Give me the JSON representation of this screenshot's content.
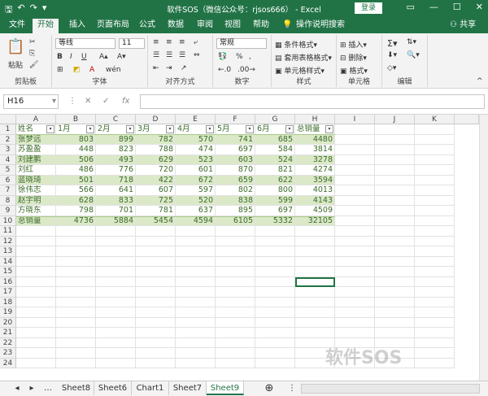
{
  "window": {
    "title": "软件SOS（微信公众号：rjsos666） - Excel",
    "login": "登录"
  },
  "tabs": [
    "文件",
    "开始",
    "插入",
    "页面布局",
    "公式",
    "数据",
    "审阅",
    "视图",
    "帮助",
    "操作说明搜索"
  ],
  "share": "共享",
  "ribbon": {
    "clipboard": {
      "paste": "粘贴",
      "label": "剪贴板"
    },
    "font": {
      "name": "等线",
      "size": "11",
      "label": "字体"
    },
    "align": {
      "label": "对齐方式"
    },
    "number": {
      "format": "常规",
      "label": "数字"
    },
    "styles": {
      "cond": "条件格式",
      "table": "套用表格格式",
      "cell": "单元格样式",
      "label": "样式"
    },
    "cells": {
      "insert": "插入",
      "delete": "删除",
      "format": "格式",
      "label": "单元格"
    },
    "edit": {
      "label": "编辑"
    }
  },
  "formula": {
    "namebox": "H16",
    "fx": "fx"
  },
  "columns": [
    "A",
    "B",
    "C",
    "D",
    "E",
    "F",
    "G",
    "H",
    "I",
    "J",
    "K"
  ],
  "rows": [
    "1",
    "2",
    "3",
    "4",
    "5",
    "6",
    "7",
    "8",
    "9",
    "10",
    "11",
    "12",
    "13",
    "14",
    "15",
    "16",
    "17",
    "18",
    "19",
    "20",
    "21",
    "22",
    "23",
    "24"
  ],
  "table": {
    "headers": [
      "姓名",
      "1月",
      "2月",
      "3月",
      "4月",
      "5月",
      "6月",
      "总销量"
    ],
    "data": [
      [
        "张梦远",
        "803",
        "899",
        "782",
        "570",
        "741",
        "685",
        "4480"
      ],
      [
        "苏盈盈",
        "448",
        "823",
        "788",
        "474",
        "697",
        "584",
        "3814"
      ],
      [
        "刘建鹏",
        "506",
        "493",
        "629",
        "523",
        "603",
        "524",
        "3278"
      ],
      [
        "刘红",
        "486",
        "776",
        "720",
        "601",
        "870",
        "821",
        "4274"
      ],
      [
        "蓝晓琦",
        "501",
        "718",
        "422",
        "672",
        "659",
        "622",
        "3594"
      ],
      [
        "徐伟志",
        "566",
        "641",
        "607",
        "597",
        "802",
        "800",
        "4013"
      ],
      [
        "赵宇明",
        "628",
        "833",
        "725",
        "520",
        "838",
        "599",
        "4143"
      ],
      [
        "方晓东",
        "798",
        "701",
        "781",
        "637",
        "895",
        "697",
        "4509"
      ],
      [
        "总销量",
        "4736",
        "5884",
        "5454",
        "4594",
        "6105",
        "5332",
        "32105"
      ]
    ]
  },
  "sheets": [
    "Sheet8",
    "Sheet6",
    "Chart1",
    "Sheet7",
    "Sheet9"
  ],
  "watermark": "软件SOS"
}
